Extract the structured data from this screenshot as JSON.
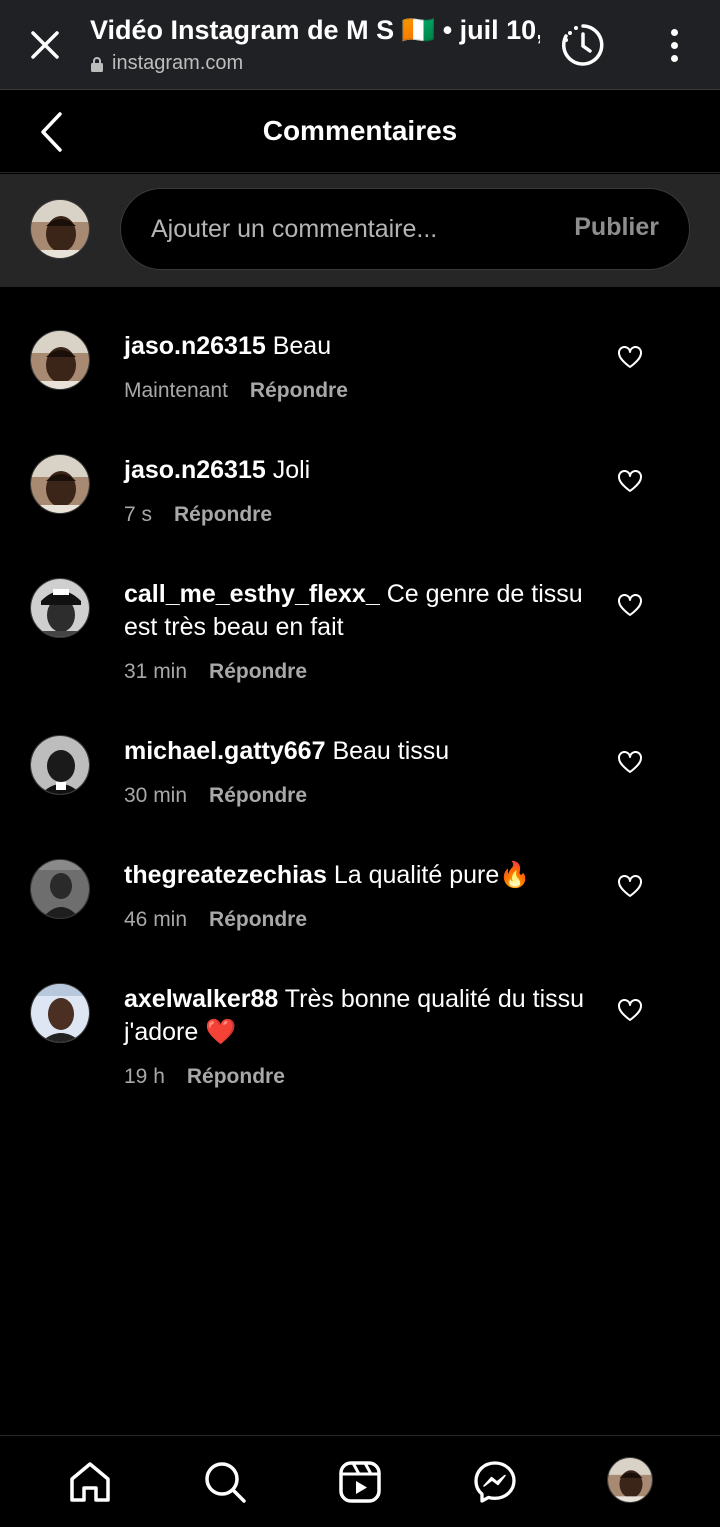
{
  "browser": {
    "title": "Vidéo Instagram de M S 🇨🇮 • juil 10,",
    "url": "instagram.com"
  },
  "header": {
    "title": "Commentaires"
  },
  "composer": {
    "placeholder": "Ajouter un commentaire...",
    "publish_label": "Publier"
  },
  "comments": [
    {
      "user": "jaso.n26315",
      "text": "Beau",
      "time": "Maintenant",
      "reply": "Répondre"
    },
    {
      "user": "jaso.n26315",
      "text": "Joli",
      "time": "7 s",
      "reply": "Répondre"
    },
    {
      "user": "call_me_esthy_flexx_",
      "text": "Ce genre de tissu est très beau en fait",
      "time": "31 min",
      "reply": "Répondre"
    },
    {
      "user": "michael.gatty667",
      "text": "Beau tissu",
      "time": "30 min",
      "reply": "Répondre"
    },
    {
      "user": "thegreatezechias",
      "text": "La qualité pure🔥",
      "time": "46 min",
      "reply": "Répondre"
    },
    {
      "user": "axelwalker88",
      "text": "Très bonne qualité du tissu j'adore ❤️",
      "time": "19 h",
      "reply": "Répondre"
    }
  ],
  "nav": {
    "items": [
      "home-icon",
      "search-icon",
      "reels-icon",
      "messenger-icon",
      "profile-avatar"
    ]
  },
  "colors": {
    "background": "#000000",
    "browser_bar": "#202124",
    "composer_bg": "#262626",
    "secondary_text": "#a8a8a8"
  }
}
